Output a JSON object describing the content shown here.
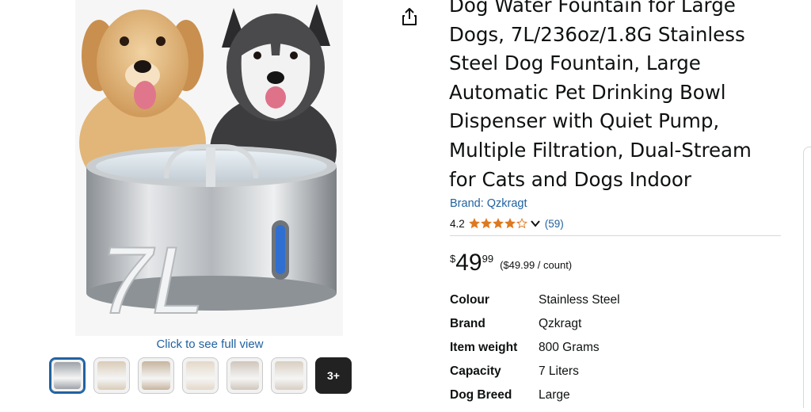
{
  "gallery": {
    "see_full_view": "Click to see full view",
    "fountain_label": "7L",
    "thumbnails": [
      {
        "selected": true,
        "color": "#9ea3a8"
      },
      {
        "selected": false,
        "color": "#d9cbb8"
      },
      {
        "selected": false,
        "color": "#c7b59e"
      },
      {
        "selected": false,
        "color": "#e4d8c8"
      },
      {
        "selected": false,
        "color": "#cfc6bb"
      },
      {
        "selected": false,
        "color": "#d8cec2"
      }
    ],
    "more_label": "3+"
  },
  "product": {
    "title": "Dog Water Fountain for Large Dogs, 7L/236oz/1.8G Stainless Steel Dog Fountain, Large Automatic Pet Drinking Bowl Dispenser with Quiet Pump, Multiple Filtration, Dual-Stream for Cats and Dogs Indoor",
    "brand_link": "Brand: Qzkragt",
    "rating": "4.2",
    "rating_value": 4.2,
    "review_count": "(59)",
    "price": {
      "symbol": "$",
      "whole": "49",
      "fraction": "99",
      "unit_price": "($49.99 / count)"
    },
    "specs": [
      {
        "label": "Colour",
        "value": "Stainless Steel"
      },
      {
        "label": "Brand",
        "value": "Qzkragt"
      },
      {
        "label": "Item weight",
        "value": "800 Grams"
      },
      {
        "label": "Capacity",
        "value": "7 Liters"
      },
      {
        "label": "Dog Breed",
        "value": "Large"
      }
    ]
  },
  "colors": {
    "link": "#2162a1",
    "star": "#de7921",
    "text": "#0f1111"
  },
  "icons": {
    "share": "share-icon",
    "star": "star-icon",
    "chevron": "chevron-down-icon"
  }
}
